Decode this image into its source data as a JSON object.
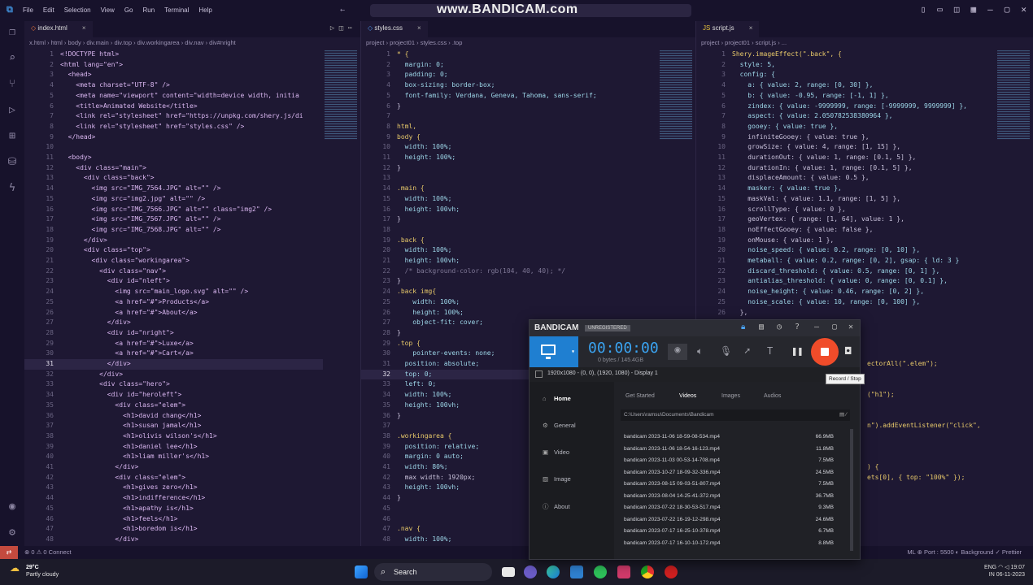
{
  "titlebar": {
    "menus": [
      "File",
      "Edit",
      "Selection",
      "View",
      "Go",
      "Run",
      "Terminal",
      "Help"
    ],
    "watermark": "www.BANDICAM.com"
  },
  "panes": [
    {
      "tab": "index.html",
      "crumbs": "x.html  ›  html  ›  body  ›  div.main  ›  div.top  ›  div.workingarea  ›  div.nav  ›  div#nright",
      "start": 1,
      "highlight": 31,
      "lines": [
        "<!DOCTYPE html>",
        "<html lang=\"en\">",
        "  <head>",
        "    <meta charset=\"UTF-8\" />",
        "    <meta name=\"viewport\" content=\"width=device width, initia",
        "    <title>Animated Website</title>",
        "    <link rel=\"stylesheet\" href=\"https://unpkg.com/shery.js/di",
        "    <link rel=\"stylesheet\" href=\"styles.css\" />",
        "  </head>",
        "",
        "  <body>",
        "    <div class=\"main\">",
        "      <div class=\"back\">",
        "        <img src=\"IMG_7564.JPG\" alt=\"\" />",
        "        <img src=\"img2.jpg\" alt=\"\" />",
        "        <img src=\"IMG_7566.JPG\" alt=\"\" class=\"img2\" />",
        "        <img src=\"IMG_7567.JPG\" alt=\"\" />",
        "        <img src=\"IMG_7568.JPG\" alt=\"\" />",
        "      </div>",
        "      <div class=\"top\">",
        "        <div class=\"workingarea\">",
        "          <div class=\"nav\">",
        "            <div id=\"nleft\">",
        "              <img src=\"main_logo.svg\" alt=\"\" />",
        "              <a href=\"#\">Products</a>",
        "              <a href=\"#\">About</a>",
        "            </div>",
        "            <div id=\"nright\">",
        "              <a href=\"#\">Luxe</a>",
        "              <a href=\"#\">Cart</a>",
        "            </div>",
        "          </div>",
        "          <div class=\"hero\">",
        "            <div id=\"heroleft\">",
        "              <div class=\"elem\">",
        "                <h1>david chang</h1>",
        "                <h1>susan jamal</h1>",
        "                <h1>olivis wilson's</h1>",
        "                <h1>daniel lee</h1>",
        "                <h1>liam miller's</h1>",
        "              </div>",
        "              <div class=\"elem\">",
        "                <h1>gives zero</h1>",
        "                <h1>indifference</h1>",
        "                <h1>apathy is</h1>",
        "                <h1>feels</h1>",
        "                <h1>boredom is</h1>",
        "              </div>"
      ]
    },
    {
      "tab": "styles.css",
      "crumbs": "project  ›  project01  ›  styles.css  ›  .top",
      "start": 1,
      "highlight": 32,
      "lines": [
        "* {",
        "  margin: 0;",
        "  padding: 0;",
        "  box-sizing: border-box;",
        "  font-family: Verdana, Geneva, Tahoma, sans-serif;",
        "}",
        "",
        "html,",
        "body {",
        "  width: 100%;",
        "  height: 100%;",
        "}",
        "",
        ".main {",
        "  width: 100%;",
        "  height: 100vh;",
        "}",
        "",
        ".back {",
        "  width: 100%;",
        "  height: 100vh;",
        "  /* background-color: rgb(104, 40, 40); */",
        "}",
        ".back img{",
        "    width: 100%;",
        "    height: 100%;",
        "    object-fit: cover;",
        "}",
        ".top {",
        "    pointer-events: none;",
        "  position: absolute;",
        "  top: 0;",
        "  left: 0;",
        "  width: 100%;",
        "  height: 100vh;",
        "}",
        "",
        ".workingarea {",
        "  position: relative;",
        "  margin: 0 auto;",
        "  width: 80%;",
        "  max width: 1920px;",
        "  height: 100vh;",
        "}",
        "",
        "",
        ".nav {",
        "  width: 100%;"
      ]
    },
    {
      "tab": "script.js",
      "crumbs": "project  ›  project01  ›  script.js  ›  ...",
      "start": 1,
      "highlight": 0,
      "lines": [
        "Shery.imageEffect(\".back\", {",
        "  style: 5,",
        "  config: {",
        "    a: { value: 2, range: [0, 30] },",
        "    b: { value: -0.95, range: [-1, 1] },",
        "    zindex: { value: -9999999, range: [-9999999, 9999999] },",
        "    aspect: { value: 2.050782538380964 },",
        "    gooey: { value: true },",
        "    infiniteGooey: { value: true },",
        "    growSize: { value: 4, range: [1, 15] },",
        "    durationOut: { value: 1, range: [0.1, 5] },",
        "    durationIn: { value: 1, range: [0.1, 5] },",
        "    displaceAmount: { value: 0.5 },",
        "    masker: { value: true },",
        "    maskVal: { value: 1.1, range: [1, 5] },",
        "    scrollType: { value: 0 },",
        "    geoVertex: { range: [1, 64], value: 1 },",
        "    noEffectGooey: { value: false },",
        "    onMouse: { value: 1 },",
        "    noise_speed: { value: 0.2, range: [0, 10] },",
        "    metaball: { value: 0.2, range: [0, 2], gsap: { ld: 3 }",
        "    discard_threshold: { value: 0.5, range: [0, 1] },",
        "    antialias_threshold: { value: 0, range: [0, 0.1] },",
        "    noise_height: { value: 0.46, range: [0, 2] },",
        "    noise_scale: { value: 10, range: [0, 100] },",
        "  },"
      ],
      "extra_right": [
        {
          "line": 31,
          "text": "ectorAll(\".elem\");"
        },
        {
          "line": 34,
          "text": "(\"h1\");"
        },
        {
          "line": 37,
          "text": "n\").addEventListener(\"click\","
        },
        {
          "line": 41,
          "text": ") {"
        },
        {
          "line": 42,
          "text": "ets[0], { top: \"100%\" });"
        }
      ]
    }
  ],
  "statusbar": {
    "left": "⊗ 0  ⚠ 0    Connect",
    "right": "ML    ⊕ Port : 5500    ◐ Background    ✓ Prettier"
  },
  "taskbar": {
    "weather_temp": "29°C",
    "weather_desc": "Partly cloudy",
    "search_label": "Search",
    "lang": "ENG",
    "region": "IN",
    "time": "19:07",
    "date": "06-11-2023"
  },
  "bandicam": {
    "brand": "BANDICAM",
    "unregistered": "UNREGISTERED",
    "timer": "00:00:00",
    "bytes": "0 bytes / 145.4GB",
    "region": "1920x1080 - (0, 0), (1920, 1080) - Display 1",
    "tooltip": "Record / Stop",
    "nav": [
      "Home",
      "General",
      "Video",
      "Image",
      "About"
    ],
    "tabs": [
      "Get Started",
      "Videos",
      "Images",
      "Audios"
    ],
    "path": "C:\\Users\\ramsu\\Documents\\Bandicam",
    "files": [
      {
        "name": "bandicam 2023-11-06 18-59-08-534.mp4",
        "size": "66.9MB"
      },
      {
        "name": "bandicam 2023-11-06 18-54-16-123.mp4",
        "size": "11.8MB"
      },
      {
        "name": "bandicam 2023-11-03 00-53-14-708.mp4",
        "size": "7.5MB"
      },
      {
        "name": "bandicam 2023-10-27 18-09-32-336.mp4",
        "size": "24.5MB"
      },
      {
        "name": "bandicam 2023-08-15 09-03-51-807.mp4",
        "size": "7.5MB"
      },
      {
        "name": "bandicam 2023-08-04 14-25-41-372.mp4",
        "size": "36.7MB"
      },
      {
        "name": "bandicam 2023-07-22 18-30-53-517.mp4",
        "size": "9.3MB"
      },
      {
        "name": "bandicam 2023-07-22 16-19-12-298.mp4",
        "size": "24.6MB"
      },
      {
        "name": "bandicam 2023-07-17 16-25-10-378.mp4",
        "size": "6.7MB"
      },
      {
        "name": "bandicam 2023-07-17 16-10-10-172.mp4",
        "size": "8.8MB"
      }
    ]
  }
}
